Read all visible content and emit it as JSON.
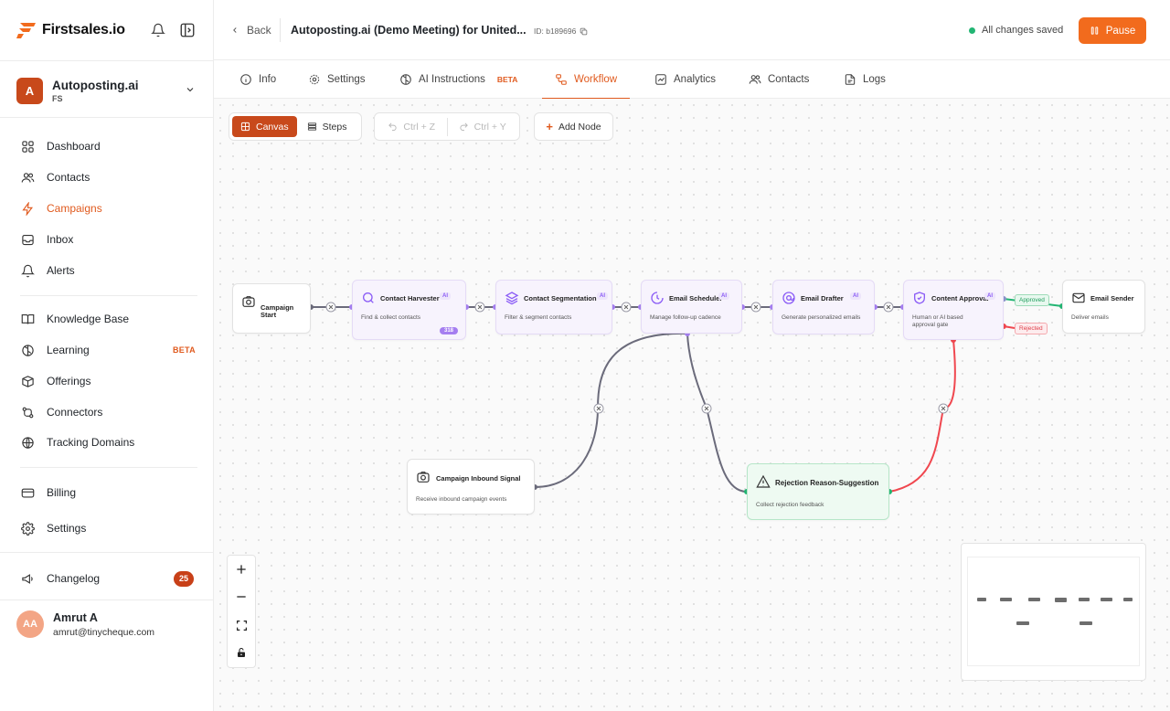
{
  "brand": {
    "name": "Firstsales.io",
    "accent": "#f26b1d"
  },
  "workspace": {
    "initial": "A",
    "name": "Autoposting.ai",
    "sub": "FS"
  },
  "nav": {
    "items": [
      {
        "label": "Dashboard",
        "icon": "grid-icon"
      },
      {
        "label": "Contacts",
        "icon": "users-icon"
      },
      {
        "label": "Campaigns",
        "icon": "bolt-icon"
      },
      {
        "label": "Inbox",
        "icon": "inbox-icon"
      },
      {
        "label": "Alerts",
        "icon": "bell-icon"
      },
      {
        "label": "Knowledge Base",
        "icon": "book-icon"
      },
      {
        "label": "Learning",
        "icon": "brain-icon",
        "badge": "BETA"
      },
      {
        "label": "Offerings",
        "icon": "box-icon"
      },
      {
        "label": "Connectors",
        "icon": "link-icon"
      },
      {
        "label": "Tracking Domains",
        "icon": "globe-icon"
      },
      {
        "label": "Billing",
        "icon": "card-icon"
      },
      {
        "label": "Settings",
        "icon": "gear-icon"
      },
      {
        "label": "Changelog",
        "icon": "megaphone-icon",
        "count": "25"
      }
    ],
    "active": "Campaigns"
  },
  "user": {
    "initials": "AA",
    "name": "Amrut A",
    "email": "amrut@tinycheque.com"
  },
  "header": {
    "back_label": "Back",
    "title": "Autoposting.ai (Demo Meeting) for United...",
    "id_label": "ID: b189696",
    "saved_label": "All changes saved",
    "pause_label": "Pause"
  },
  "tabs": [
    {
      "label": "Info"
    },
    {
      "label": "Settings"
    },
    {
      "label": "AI Instructions",
      "badge": "BETA"
    },
    {
      "label": "Workflow"
    },
    {
      "label": "Analytics"
    },
    {
      "label": "Contacts"
    },
    {
      "label": "Logs"
    }
  ],
  "active_tab": "Workflow",
  "toolbar": {
    "canvas_label": "Canvas",
    "steps_label": "Steps",
    "undo_label": "Ctrl + Z",
    "redo_label": "Ctrl + Y",
    "add_node_label": "Add Node"
  },
  "nodes": {
    "start": {
      "title": "Campaign Start"
    },
    "harvester": {
      "title": "Contact Harvester",
      "desc": "Find & collect contacts",
      "badge": "AI",
      "count": "318"
    },
    "segmentation": {
      "title": "Contact Segmentation",
      "desc": "Filter & segment contacts",
      "badge": "AI"
    },
    "scheduler": {
      "title": "Email Scheduler",
      "desc": "Manage follow-up cadence",
      "badge": "AI"
    },
    "drafter": {
      "title": "Email Drafter",
      "desc": "Generate personalized emails",
      "badge": "AI"
    },
    "approval": {
      "title": "Content Approval",
      "desc": "Human or AI based approval gate",
      "badge": "AI"
    },
    "sender": {
      "title": "Email Sender",
      "desc": "Deliver emails"
    },
    "inbound": {
      "title": "Campaign Inbound Signal",
      "desc": "Receive inbound campaign events"
    },
    "rejection": {
      "title": "Rejection Reason-Suggestion",
      "desc": "Collect rejection feedback"
    }
  },
  "edge_labels": {
    "approved": "Approved",
    "rejected": "Rejected"
  },
  "colors": {
    "edge": "#6b6b7b",
    "approved": "#22b573",
    "rejected": "#f0474f",
    "ai_purple": "#8b5cf6"
  }
}
